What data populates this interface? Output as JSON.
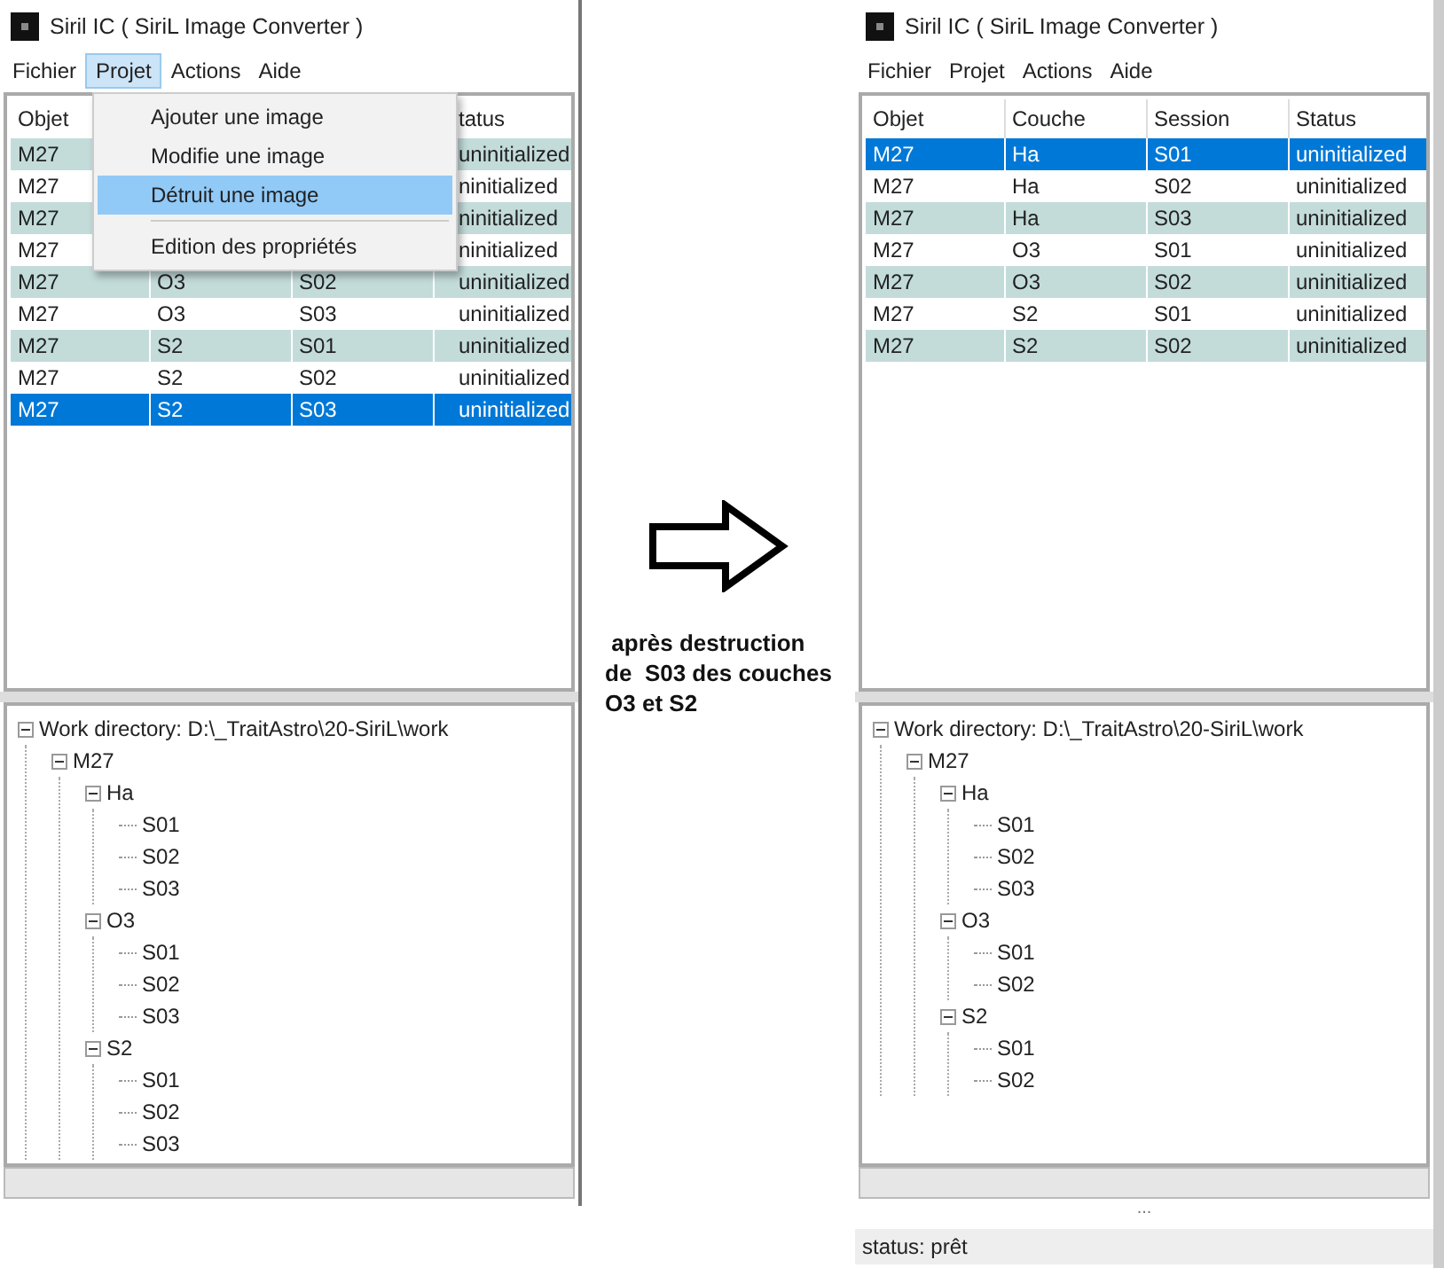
{
  "windows": [
    {
      "title": "Siril IC  ( SiriL Image Converter )",
      "menu": [
        {
          "label": "Fichier",
          "selected": false
        },
        {
          "label": "Projet",
          "selected": true
        },
        {
          "label": "Actions",
          "selected": false
        },
        {
          "label": "Aide",
          "selected": false
        }
      ],
      "dropdown": {
        "items": [
          {
            "kind": "item",
            "label": "Ajouter une image",
            "selected": false
          },
          {
            "kind": "item",
            "label": "Modifie une image",
            "selected": false
          },
          {
            "kind": "item",
            "label": "Détruit une image",
            "selected": true
          },
          {
            "kind": "separator"
          },
          {
            "kind": "item",
            "label": "Edition des propriétés",
            "selected": false
          }
        ]
      },
      "table": {
        "columns": [
          "Objet",
          null,
          null,
          "tatus"
        ],
        "rows": [
          {
            "cells": [
              "M27",
              null,
              null,
              "uninitialized"
            ],
            "selected": false
          },
          {
            "cells": [
              "M27",
              null,
              null,
              "ninitialized"
            ],
            "selected": false
          },
          {
            "cells": [
              "M27",
              null,
              null,
              "ninitialized"
            ],
            "selected": false
          },
          {
            "cells": [
              "M27",
              null,
              null,
              "ninitialized"
            ],
            "selected": false
          },
          {
            "cells": [
              "M27",
              "O3",
              "S02",
              "uninitialized"
            ],
            "selected": false
          },
          {
            "cells": [
              "M27",
              "O3",
              "S03",
              "uninitialized"
            ],
            "selected": false
          },
          {
            "cells": [
              "M27",
              "S2",
              "S01",
              "uninitialized"
            ],
            "selected": false
          },
          {
            "cells": [
              "M27",
              "S2",
              "S02",
              "uninitialized"
            ],
            "selected": false
          },
          {
            "cells": [
              "M27",
              "S2",
              "S03",
              "uninitialized"
            ],
            "selected": true
          }
        ]
      },
      "tree": [
        {
          "label": "Work directory: D:\\_TraitAstro\\20-SiriL\\work",
          "expanded": true,
          "children": [
            {
              "label": "M27",
              "expanded": true,
              "children": [
                {
                  "label": "Ha",
                  "expanded": true,
                  "children": [
                    {
                      "label": "S01"
                    },
                    {
                      "label": "S02"
                    },
                    {
                      "label": "S03"
                    }
                  ]
                },
                {
                  "label": "O3",
                  "expanded": true,
                  "children": [
                    {
                      "label": "S01"
                    },
                    {
                      "label": "S02"
                    },
                    {
                      "label": "S03"
                    }
                  ]
                },
                {
                  "label": "S2",
                  "expanded": true,
                  "children": [
                    {
                      "label": "S01"
                    },
                    {
                      "label": "S02"
                    },
                    {
                      "label": "S03"
                    }
                  ]
                }
              ]
            }
          ]
        }
      ]
    },
    {
      "title": "Siril IC  ( SiriL Image Converter )",
      "menu": [
        {
          "label": "Fichier",
          "selected": false
        },
        {
          "label": "Projet",
          "selected": false
        },
        {
          "label": "Actions",
          "selected": false
        },
        {
          "label": "Aide",
          "selected": false
        }
      ],
      "table": {
        "columns": [
          "Objet",
          "Couche",
          "Session",
          "Status"
        ],
        "rows": [
          {
            "cells": [
              "M27",
              "Ha",
              "S01",
              "uninitialized"
            ],
            "selected": true
          },
          {
            "cells": [
              "M27",
              "Ha",
              "S02",
              "uninitialized"
            ],
            "selected": false
          },
          {
            "cells": [
              "M27",
              "Ha",
              "S03",
              "uninitialized"
            ],
            "selected": false
          },
          {
            "cells": [
              "M27",
              "O3",
              "S01",
              "uninitialized"
            ],
            "selected": false
          },
          {
            "cells": [
              "M27",
              "O3",
              "S02",
              "uninitialized"
            ],
            "selected": false
          },
          {
            "cells": [
              "M27",
              "S2",
              "S01",
              "uninitialized"
            ],
            "selected": false
          },
          {
            "cells": [
              "M27",
              "S2",
              "S02",
              "uninitialized"
            ],
            "selected": false
          }
        ]
      },
      "tree": [
        {
          "label": "Work directory: D:\\_TraitAstro\\20-SiriL\\work",
          "expanded": true,
          "children": [
            {
              "label": "M27",
              "expanded": true,
              "children": [
                {
                  "label": "Ha",
                  "expanded": true,
                  "children": [
                    {
                      "label": "S01"
                    },
                    {
                      "label": "S02"
                    },
                    {
                      "label": "S03"
                    }
                  ]
                },
                {
                  "label": "O3",
                  "expanded": true,
                  "children": [
                    {
                      "label": "S01"
                    },
                    {
                      "label": "S02"
                    }
                  ]
                },
                {
                  "label": "S2",
                  "expanded": true,
                  "children": [
                    {
                      "label": "S01"
                    },
                    {
                      "label": "S02"
                    }
                  ]
                }
              ]
            }
          ]
        }
      ],
      "handle": "...",
      "status": "status: prêt"
    }
  ],
  "caption": " après destruction\nde  S03 des couches\nO3 et S2"
}
